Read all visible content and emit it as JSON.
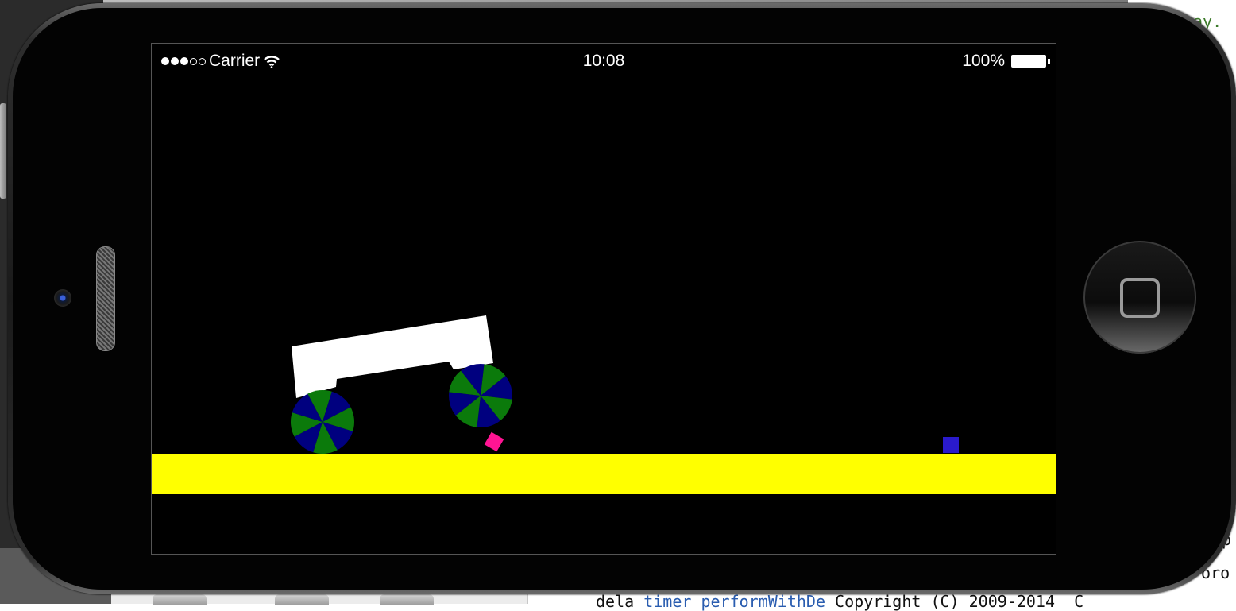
{
  "background_ide": {
    "top_right_code": "ay.",
    "bottom_code_prefix": "dela",
    "bottom_code_link": "timer performWithDe",
    "bottom_copyright": "Copyright (C) 2009-2014  C",
    "right_fragment_1": "p",
    "right_fragment_2": "oro"
  },
  "status_bar": {
    "carrier": "Carrier",
    "time": "10:08",
    "battery": "100%",
    "signal_bars_filled": 3,
    "signal_bars_total": 5
  },
  "game": {
    "ground_color": "#ffff00",
    "chassis_color": "#ffffff",
    "wheel_colors": [
      "#00007f",
      "#0b7a0b"
    ],
    "small_box_colors": [
      "#ff1493",
      "#2a1acc"
    ]
  },
  "colors": {
    "screen_bg": "#000000",
    "phone_body": "#1b1b1b"
  }
}
